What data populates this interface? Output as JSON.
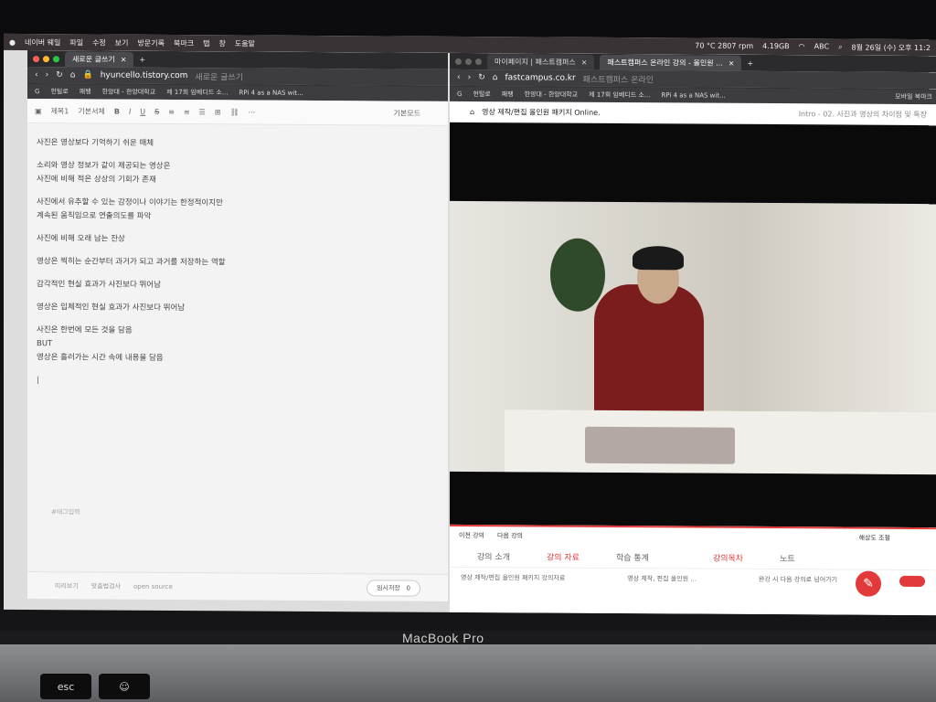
{
  "menubar": {
    "items": [
      "네이버 웨일",
      "파일",
      "수정",
      "보기",
      "방문기록",
      "북마크",
      "탭",
      "창",
      "도움말"
    ],
    "temp": "70 °C 2807 rpm",
    "storage": "4.19GB",
    "input": "ABC",
    "clock": "8월 26일 (수) 오후 11:2"
  },
  "left_window": {
    "tab_title": "새로운 글쓰기",
    "url": "hyuncello.tistory.com",
    "url_hint": "새로운 글쓰기",
    "bookmarks": [
      "G",
      "헌털로",
      "패팽",
      "한양대 - 한양대학교",
      "제 17회 임베디드 소...",
      "RPi 4 as a NAS wit...",
      "모바일 북마크"
    ],
    "toolbar": {
      "heading": "제목1",
      "style": "기본서체",
      "mode": "기본모드"
    },
    "paragraphs": [
      [
        "사진은 영상보다 기억하기 쉬운 매체"
      ],
      [
        "소리와 영상 정보가 같이 제공되는 영상은",
        "사진에 비해 적은 상상의 기회가 존재"
      ],
      [
        "사진에서 유추할 수 있는 감정이나 이야기는 한정적이지만",
        "계속된 움직임으로 연출의도를 파악"
      ],
      [
        "사진에 비해 오래 남는 잔상"
      ],
      [
        "영상은 찍히는 순간부터 과거가 되고 과거를 저장하는 역할"
      ],
      [
        "감각적인 현실 효과가 사진보다 뛰어남"
      ],
      [
        "영상은 입체적인 현실 효과가 사진보다 뛰어남"
      ],
      [
        "사진은 한번에 모든 것을 담음",
        "BUT",
        "영상은 흘러가는 시간 속에 내용을 담음"
      ]
    ],
    "tag_placeholder": "#태그입력",
    "bottom": {
      "preview": "미리보기",
      "spell": "맞춤법검사",
      "open_source": "open source",
      "temp_save": "임시저장",
      "temp_count": "0"
    }
  },
  "right_window": {
    "tabs": [
      "마이페이지 | 패스트캠퍼스",
      "패스트캠퍼스 온라인 강의 - 올인원 ..."
    ],
    "url": "fastcampus.co.kr",
    "url_hint": "패스트캠퍼스 온라인",
    "bookmarks": [
      "G",
      "헌털로",
      "패팽",
      "한양대 - 한양대학교",
      "제 17회 임베디드 소...",
      "RPi 4 as a NAS wit...",
      "모바일 북마크"
    ],
    "course_title": "영상 제작/편집 올인원 패키지 Online.",
    "section": "Intro - 02. 사진과 영상의 차이점 및 특장",
    "player_controls": {
      "prev": "이전 강의",
      "next": "다음 강의",
      "quality": "해상도 조절"
    },
    "tabs_bottom": [
      "강의 소개",
      "강의 자료",
      "학습 통계"
    ],
    "active_tab": "강의 자료",
    "side_tabs": [
      "강의목차",
      "노트"
    ],
    "material": "영상 제작/편집 올인원 패키지 강의자료",
    "material_file": "영상 제작, 편집 올인원 ...",
    "autoplay": "완강 시 다음 강의로 넘어가기"
  },
  "laptop": {
    "brand": "MacBook Pro",
    "keys": [
      "esc"
    ]
  }
}
